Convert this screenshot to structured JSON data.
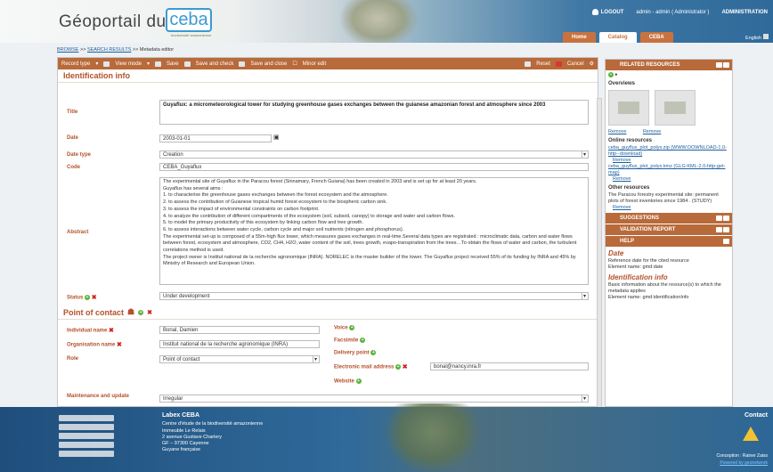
{
  "header": {
    "logo_text": "Géoportail du",
    "logo_ceba": "ceba",
    "logo_sub": "biodiversité amazonienne",
    "logout": "LOGOUT",
    "user": "admin - admin ( Administrator )",
    "administration": "ADMINISTRATION",
    "tabs": [
      "Home",
      "Catalog",
      "CEBA"
    ],
    "language": "English"
  },
  "breadcrumb": {
    "browse": "BROWSE",
    "sep": ">>",
    "search": "SEARCH RESULTS",
    "current": ">> Metadata editor"
  },
  "toolbar": {
    "record_type": "Record type",
    "view_mode": "View mode",
    "save": "Save",
    "save_check": "Save and check",
    "save_close": "Save and close",
    "minor": "Minor edit",
    "reset": "Reset",
    "cancel": "Cancel"
  },
  "identification": {
    "section": "Identification info",
    "title_label": "Title",
    "title_value": "Guyaflux: a micrometeorological tower for studying greenhouse gases exchanges between the guianese amazonian forest and atmosphere since 2003",
    "date_label": "Date",
    "date_value": "2003-01-01",
    "date_type_label": "Date type",
    "date_type_value": "Creation",
    "code_label": "Code",
    "code_value": "CEBA_Guyaflux",
    "abstract_label": "Abstract",
    "abstract_value": "The experimental site of Guyaflux in the Paracou forest (Sinnamary, French Guiana) has been created in 2003 and is set up for at least 20 years.\nGuyaflux has several aims :\n1. to characterise the greenhouse gases exchanges between the forest ecosystem and the atmosphere.\n2. to assess the contribution of Guianese tropical humid forest ecosystem to the biospheric carbon sink.\n3. to assess the impact of environmental constraints on carbon footprint.\n4. to analyze the contribution of different compartments of the ecosystem (soil, subsoil, canopy) to storage and water and carbon flows.\n5. to model the primary productivity of this ecosystem by linking carbon flow and tree growth.\n6. to assess interactions between water cycle, carbon cycle and major soil nutrients (nitrogen and phosphorus).\nThe experimental set-up is composed of a 55m-high flux tower, which measures gases exchanges in real-time.Several data types are registrated : microclimatic data, carbon and water flows between forest, ecosystem and atmosphere, CO2, CH4, H2O, water content of the soil, trees growth, evapo-transpiration from the trees…To obtain the flows of water and carbon, the turbulent correlations method is used.\nThe project owner is Institut national de la recherche agronomique (INRA). NORELEC is the master builder of the tower. The Guyaflux project received 55% of its funding by INRA and 45% by Ministry of Research and European Union.",
    "status_label": "Status",
    "status_value": "Under development"
  },
  "contact": {
    "section": "Point of contact",
    "individual_label": "Individual name",
    "individual_value": "Bonal, Damien",
    "org_label": "Organisation name",
    "org_value": "Institut national de la recherche agronomique (INRA)",
    "role_label": "Role",
    "role_value": "Point of contact",
    "voice": "Voice",
    "facsimile": "Facsimile",
    "delivery": "Delivery point",
    "email_label": "Electronic mail address",
    "email_value": "bonal@nancy.inra.fr",
    "website": "Website",
    "maintenance_label": "Maintenance and update frequency",
    "maintenance_value": "Irregular"
  },
  "sidebar": {
    "related": "Related resources",
    "overviews": "Overviews",
    "remove": "Remove",
    "online": "Online resources",
    "online_1": "ceba_guyflux_plot_polys.zip (WWW:DOWNLOAD-1.0-http--download)",
    "online_2": "ceba_guyflux_plot_polys.kmz (GLG:KML-2.0-http-get-map)",
    "other": "Other resources",
    "other_1": "The Paracou forestry experimental site: permanent plots of forest inventories since 1984 . (STUDY)",
    "suggestions": "Suggestions",
    "validation": "Validation report",
    "help": "Help",
    "help_date_title": "Date",
    "help_date_text": "Reference date for the cited resource",
    "help_date_el": "Element name: gmd:date",
    "help_id_title": "Identification info",
    "help_id_text": "Basic information about the resource(s) to which the metadata applies",
    "help_id_el": "Element name: gmd:identificationInfo"
  },
  "footer": {
    "title": "Labex CEBA",
    "line1": "Centre d'étude de la biodiversité amazonienne",
    "line2": "Immeuble Le Relais",
    "line3": "2 avenue Gustave Charlery",
    "line4": "GF – 97300 Cayenne",
    "line5": "Guyane française",
    "contact": "Contact",
    "conception": "Conception : Rainer Zaiss",
    "powered": "Powered by geonetwork"
  }
}
